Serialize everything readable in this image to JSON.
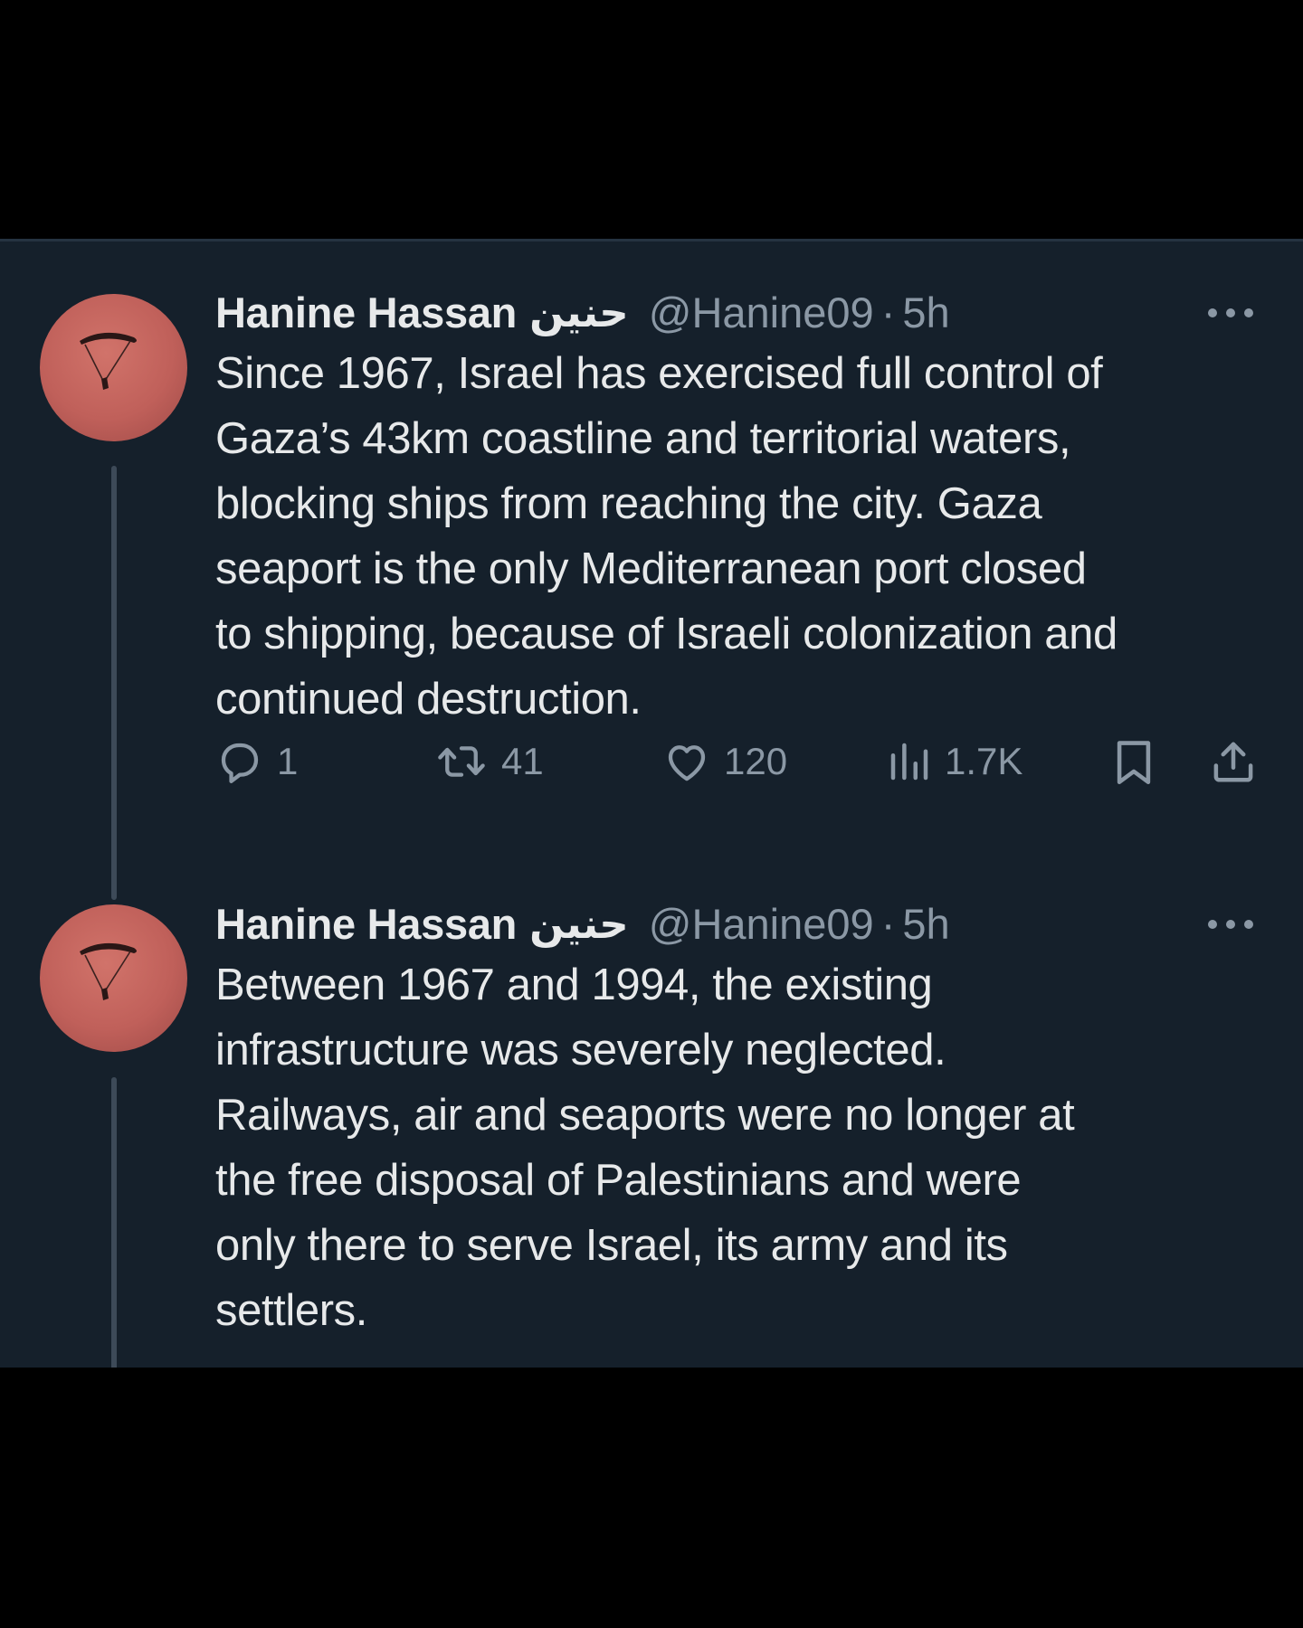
{
  "thread": {
    "tweets": [
      {
        "author": {
          "display_name": "Hanine Hassan",
          "display_name_ar": "حنين",
          "handle": "@Hanine09",
          "separator": "·",
          "time": "5h"
        },
        "text_lines": [
          "Since 1967, Israel has exercised full control of",
          "Gaza’s 43km coastline and territorial waters,",
          "blocking ships from reaching the city. Gaza",
          "seaport is the only Mediterranean port closed",
          "to shipping, because of Israeli colonization and",
          "continued destruction."
        ],
        "actions": {
          "replies": "1",
          "retweets": "41",
          "likes": "120",
          "views": "1.7K"
        }
      },
      {
        "author": {
          "display_name": "Hanine Hassan",
          "display_name_ar": "حنين",
          "handle": "@Hanine09",
          "separator": "·",
          "time": "5h"
        },
        "text_lines": [
          "Between 1967 and 1994, the existing",
          "infrastructure was severely neglected.",
          "Railways, air and seaports were no longer at",
          "the free disposal of Palestinians and were",
          "only there to serve Israel, its army and its",
          "settlers."
        ]
      }
    ]
  },
  "icons": {
    "more": "more-horizontal-icon",
    "reply": "reply-bubble-icon",
    "retweet": "retweet-icon",
    "like": "heart-icon",
    "views": "views-bar-chart-icon",
    "bookmark": "bookmark-icon",
    "share": "share-upload-icon"
  },
  "colors": {
    "background": "#15202b",
    "outer_background": "#000000",
    "primary_text": "#e7e9ea",
    "secondary_text": "#8b98a5",
    "thread_line": "#3d4a58",
    "avatar": "#c0605a"
  }
}
